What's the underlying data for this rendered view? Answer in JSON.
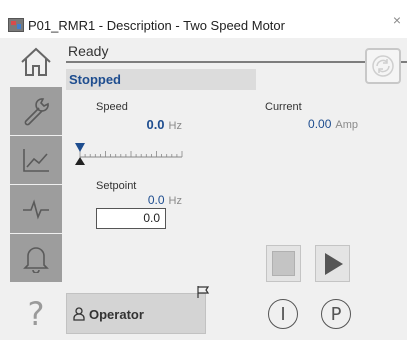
{
  "window": {
    "title": "P01_RMR1 - Description - Two Speed Motor",
    "close_glyph": "×"
  },
  "sidebar": {
    "tabs": [
      {
        "name": "home",
        "icon": "home-icon",
        "active": true
      },
      {
        "name": "maintenance",
        "icon": "wrench-icon",
        "active": false
      },
      {
        "name": "trends",
        "icon": "trend-icon",
        "active": false
      },
      {
        "name": "diagnostics",
        "icon": "pulse-icon",
        "active": false
      },
      {
        "name": "alarms",
        "icon": "bell-icon",
        "active": false
      }
    ],
    "help_glyph": "?"
  },
  "status": {
    "text": "Ready",
    "refresh_icon": "refresh-icon"
  },
  "motor": {
    "state": "Stopped",
    "speed": {
      "label": "Speed",
      "value": "0.0",
      "unit": "Hz"
    },
    "current": {
      "label": "Current",
      "value": "0.00",
      "unit": "Amp"
    },
    "speed_scale_fraction": 0,
    "setpoint": {
      "label": "Setpoint",
      "value": "0.0",
      "unit": "Hz",
      "input_value": "0.0"
    }
  },
  "commands": {
    "stop_icon": "stop-icon",
    "run_icon": "play-icon"
  },
  "operator": {
    "label": "Operator",
    "icon": "person-icon",
    "flag_icon": "flag-icon"
  },
  "modes": {
    "interlock_glyph": "I",
    "permissive_glyph": "P"
  },
  "colors": {
    "value_blue": "#1e4d8f",
    "tab_gray": "#9d9d9d",
    "background": "#f0f0f0"
  }
}
